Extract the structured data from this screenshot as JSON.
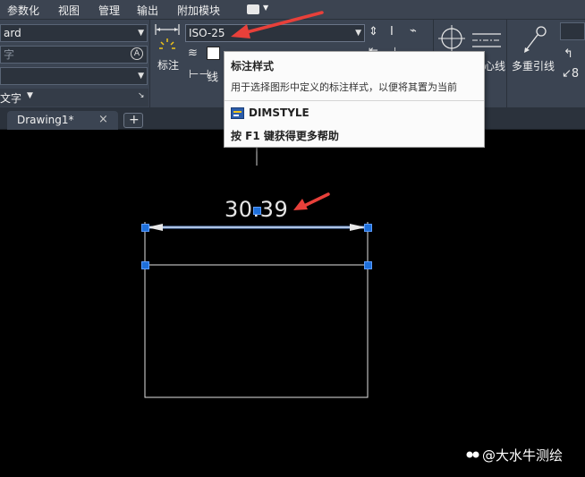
{
  "menu": {
    "items": [
      "参数化",
      "视图",
      "管理",
      "输出",
      "附加模块"
    ]
  },
  "ribbon": {
    "text_style_combo": "ard",
    "text_search_placeholder": "字",
    "text_panel_label": "文字",
    "dim_button_label": "标注",
    "dim_style_combo": "ISO-25",
    "layer_label": "线",
    "centerline_label": "心线",
    "multileader_label": "多重引线"
  },
  "tabs": {
    "active_doc": "Drawing1*",
    "close_glyph": "×",
    "new_tab_glyph": "+"
  },
  "tooltip": {
    "title": "标注样式",
    "description": "用于选择图形中定义的标注样式，以便将其置为当前",
    "command": "DIMSTYLE",
    "help_text": "按 F1 键获得更多帮助"
  },
  "drawing": {
    "dimension_text": "30.39"
  },
  "watermark": {
    "text": "@大水牛测绘"
  },
  "colors": {
    "menubar_bg": "#3c4451",
    "ribbon_bg": "#3b4452",
    "canvas_bg": "#000000",
    "grip_blue": "#1e6fd9",
    "annotation_arrow": "#e8403a"
  }
}
